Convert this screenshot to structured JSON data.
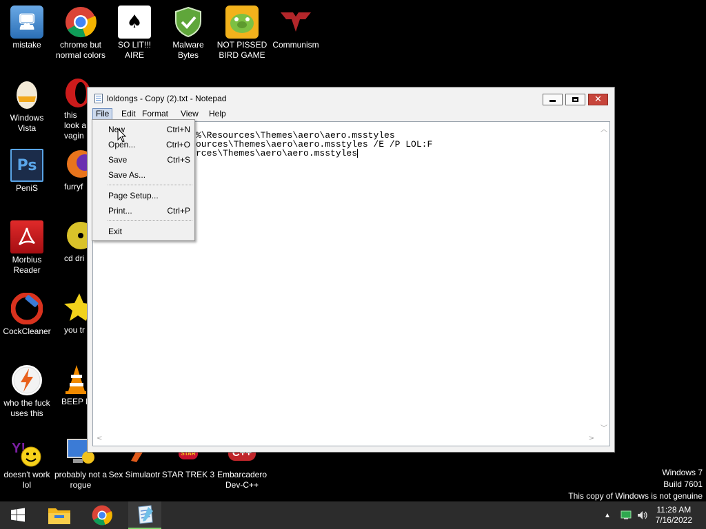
{
  "desktop": {
    "icons": [
      {
        "label": "mistake",
        "icon": "computer-icon",
        "color": "#2b6fb6"
      },
      {
        "label": "chrome but normal colors",
        "icon": "chrome-icon",
        "color": "#db4437"
      },
      {
        "label": "SO LIT!!! AIRE",
        "icon": "solitaire-icon",
        "color": "#ffffff"
      },
      {
        "label": "Malware Bytes",
        "icon": "shield-icon",
        "color": "#5fa63a"
      },
      {
        "label": "NOT PISSED BIRD GAME",
        "icon": "bad-piggies-icon",
        "color": "#f2b21c"
      },
      {
        "label": "Communism",
        "icon": "papers-please-icon",
        "color": "#b3262a"
      },
      {
        "label": "Windows Vista",
        "icon": "egg-icon",
        "color": "#e8d8b8"
      },
      {
        "label": "this looks like a vagina",
        "icon": "opera-icon",
        "color": "#cc1b1b"
      },
      {
        "label": "PeniS",
        "icon": "photoshop-icon",
        "color": "#1f4a85"
      },
      {
        "label": "furryfox",
        "icon": "firefox-icon",
        "color": "#e8741c"
      },
      {
        "label": "Morbius Reader",
        "icon": "acrobat-icon",
        "color": "#c4161c"
      },
      {
        "label": "cd drive",
        "icon": "cd-icon",
        "color": "#d9c22a"
      },
      {
        "label": "CockCleaner",
        "icon": "ccleaner-icon",
        "color": "#d9321e"
      },
      {
        "label": "you tried",
        "icon": "star-icon",
        "color": "#f2d21b"
      },
      {
        "label": "who the fuck uses this",
        "icon": "avast-icon",
        "color": "#e8601c"
      },
      {
        "label": "BEEP BOOP",
        "icon": "vlc-icon",
        "color": "#f08a00"
      },
      {
        "label": "doesn't work lol",
        "icon": "yahoo-messenger-icon",
        "color": "#7b1fa2"
      },
      {
        "label": "probably not a rogue",
        "icon": "system-tool-icon",
        "color": "#3b7bd6"
      },
      {
        "label": "Sex Simulaotr",
        "icon": "sex-simulator-icon",
        "color": "#e05a1a"
      },
      {
        "label": "STAR TREK 3",
        "icon": "star-wars-icon",
        "color": "#c8102e"
      },
      {
        "label": "Embarcadero Dev-C++",
        "icon": "cpp-icon",
        "color": "#c0262b"
      }
    ],
    "visible_labels": {
      "opera": "this look a vagin",
      "firefox": "furryf",
      "cd": "cd dri",
      "star": "you tr",
      "vlc": "BEEP B"
    }
  },
  "window": {
    "title": "loldongs - Copy (2).txt - Notepad",
    "menu": [
      "File",
      "Edit",
      "Format",
      "View",
      "Help"
    ],
    "active_menu": "File"
  },
  "editor": {
    "lines": [
      "%\\Resources\\Themes\\aero\\aero.msstyles",
      "ources\\Themes\\aero\\aero.msstyles /E /P LOL:F",
      "rces\\Themes\\aero\\aero.msstyles"
    ]
  },
  "file_menu": {
    "items": [
      {
        "label": "New",
        "shortcut": "Ctrl+N"
      },
      {
        "label": "Open...",
        "shortcut": "Ctrl+O"
      },
      {
        "label": "Save",
        "shortcut": "Ctrl+S"
      },
      {
        "label": "Save As...",
        "shortcut": ""
      },
      {
        "label": "Page Setup...",
        "shortcut": ""
      },
      {
        "label": "Print...",
        "shortcut": "Ctrl+P"
      },
      {
        "label": "Exit",
        "shortcut": ""
      }
    ]
  },
  "watermark": {
    "line1": "Windows 7",
    "line2": "Build 7601",
    "line3": "This copy of Windows is not genuine"
  },
  "taskbar": {
    "pinned": [
      "start-icon",
      "file-explorer-icon",
      "chrome-icon",
      "notepad-icon"
    ],
    "time": "11:28 AM",
    "date": "7/16/2022"
  }
}
